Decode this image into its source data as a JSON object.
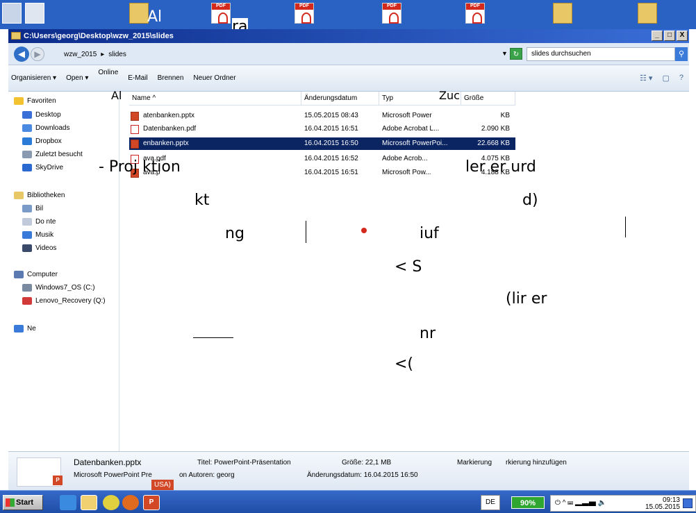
{
  "desktop": {
    "icon_label": "Al",
    "icon_label2": "ra"
  },
  "window": {
    "title": "C:\\Users\\georg\\Desktop\\wzw_2015\\slides",
    "btn_min": "_",
    "btn_max": "□",
    "btn_close": "X"
  },
  "address": {
    "crumbs": [
      "wzw_2015",
      "slides"
    ],
    "search_placeholder": "slides durchsuchen"
  },
  "toolbar": {
    "organize": "Organisieren",
    "open": "Open",
    "online": "Online",
    "email": "E-Mail",
    "burn": "Brennen",
    "new_folder": "Neuer Ordner"
  },
  "sidebar": {
    "favorites": "Favoriten",
    "desktop": "Desktop",
    "downloads": "Downloads",
    "dropbox": "Dropbox",
    "recent": "Zuletzt besucht",
    "skydrive": "SkyDrive",
    "libraries": "Bibliotheken",
    "pictures": "Bil",
    "documents": "Do     nte",
    "music": "Musik",
    "videos": "Videos",
    "computer": "Computer",
    "windows": "Windows7_OS (C:)",
    "recovery": "Lenovo_Recovery (Q:)",
    "network": "Ne"
  },
  "columns": {
    "name": "Name",
    "date": "Änderungsdatum",
    "type": "Typ",
    "size": "Größe"
  },
  "files": [
    {
      "name": "atenbanken.pptx",
      "date": "15.05.2015 08:43",
      "type": "Microsoft Power",
      "size": "KB",
      "icon": "ppt"
    },
    {
      "name": "Datenbanken.pdf",
      "date": "16.04.2015 16:51",
      "type": "Adobe Acrobat L...",
      "size": "2.090 KB",
      "icon": "pdf"
    },
    {
      "name": "enbanken.pptx",
      "date": "16.04.2015 16:50",
      "type": "Microsoft PowerPoi...",
      "size": "22.668 KB",
      "icon": "ppt"
    },
    {
      "name": "ava.pdf",
      "date": "16.04.2015 16:52",
      "type": "Adobe Acrob...",
      "size": "4.075 KB",
      "icon": "pdf"
    },
    {
      "name": "ava.p",
      "date": "16.04.2015 16:51",
      "type": "Microsoft Pow...",
      "size": "4.188 KB",
      "icon": "ppt"
    }
  ],
  "overlay": {
    "t1": "Al",
    "t2": "Zuc",
    "t3": "- Proj  ktion",
    "t4": "ler  er  urd",
    "t5": "kt",
    "t6": "d)",
    "t7": "ng",
    "t8": "iuf",
    "t9": "< S",
    "t10": "(lir   er",
    "t11": "nr",
    "t12": "<("
  },
  "details": {
    "filename": "Datenbanken.pptx",
    "filetype": "Microsoft PowerPoint Pre",
    "filetype2": "on Autoren: georg",
    "title": "Titel: PowerPoint-Präsentation",
    "size": "Größe: 22,1 MB",
    "modified": "Änderungsdatum: 16.04.2015 16:50",
    "tags": "Markierung",
    "tags_add": "rkierung hinzufügen",
    "usa": "USA)"
  },
  "taskbar": {
    "start": "Start",
    "lang": "DE",
    "battery": "90%",
    "time": "09:13",
    "date": "15.05.2015"
  }
}
